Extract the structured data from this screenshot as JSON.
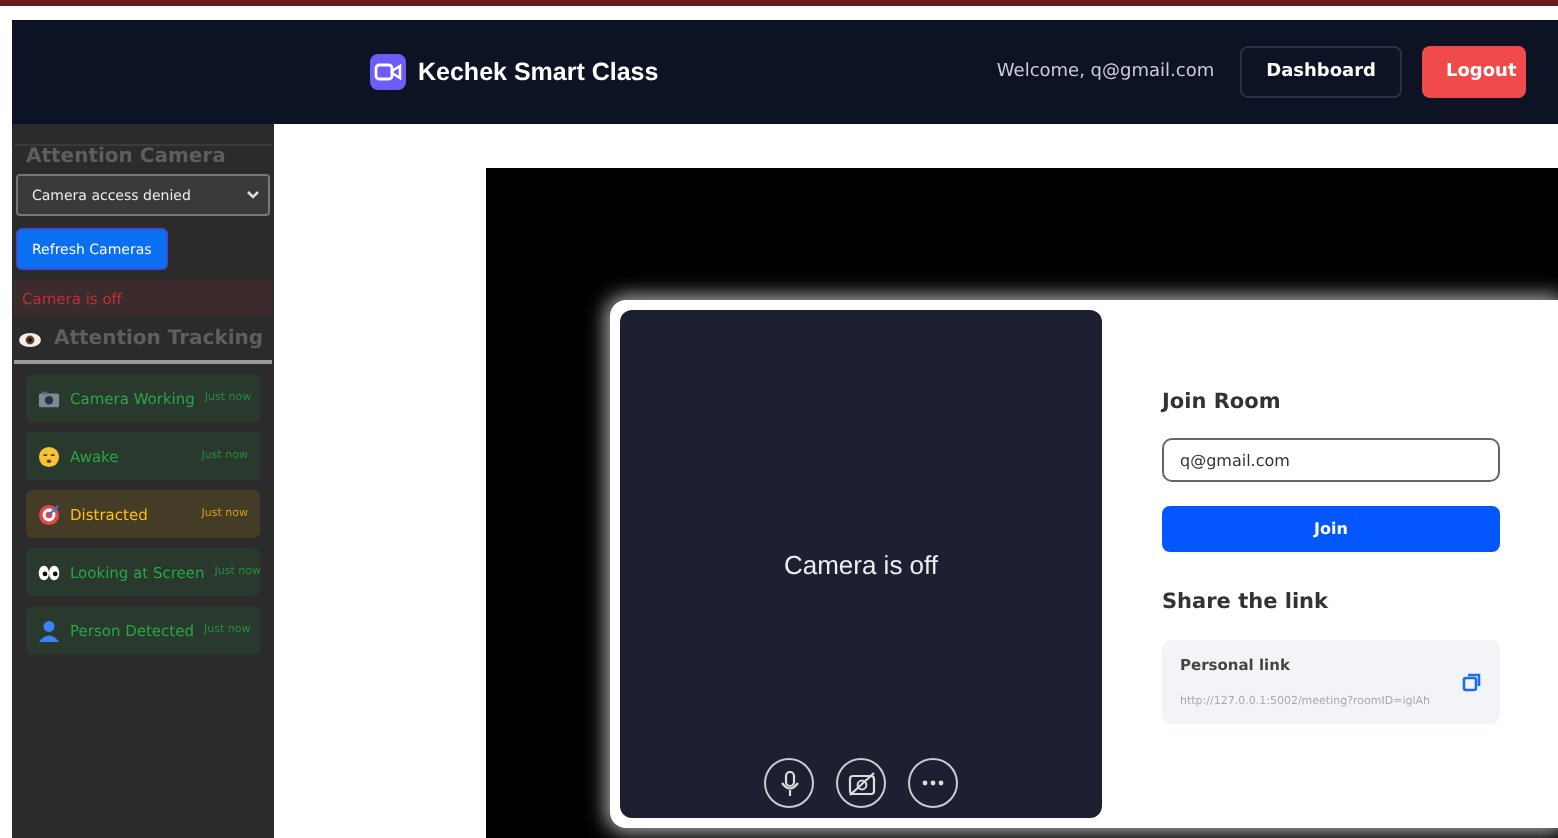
{
  "navbar": {
    "brand": "Kechek Smart Class",
    "welcome": "Welcome, q@gmail.com",
    "buttons": [
      {
        "label": "Dashboard",
        "kind": "outline"
      },
      {
        "label": "Logout",
        "kind": "danger"
      }
    ]
  },
  "sidebar": {
    "camera_title": "Attention Camera",
    "camera_select": "Camera access denied",
    "refresh_button": "Refresh Cameras",
    "camera_status": "Camera is off",
    "tracking_title": "Attention Tracking",
    "statuses": [
      {
        "kind": "camera",
        "label": "Camera Working",
        "time": "Just now",
        "color": "#28a745"
      },
      {
        "kind": "face",
        "label": "Awake",
        "time": "Just now",
        "color": "#28a745"
      },
      {
        "kind": "target",
        "label": "Distracted",
        "time": "Just now",
        "color": "#ffc107"
      },
      {
        "kind": "eyes",
        "label": "Looking at Screen",
        "time": "Just now",
        "color": "#28a745"
      },
      {
        "kind": "person",
        "label": "Person Detected",
        "time": "Just now",
        "color": "#28a745"
      }
    ]
  },
  "preview": {
    "message": "Camera is off",
    "mic_on": true,
    "camera_on": false
  },
  "join": {
    "title": "Join Room",
    "input_value": "q@gmail.com",
    "button": "Join",
    "share_title": "Share the link",
    "link_label": "Personal link",
    "link_url": "http://127.0.0.1:5002/meeting?roomID=iglAh"
  }
}
